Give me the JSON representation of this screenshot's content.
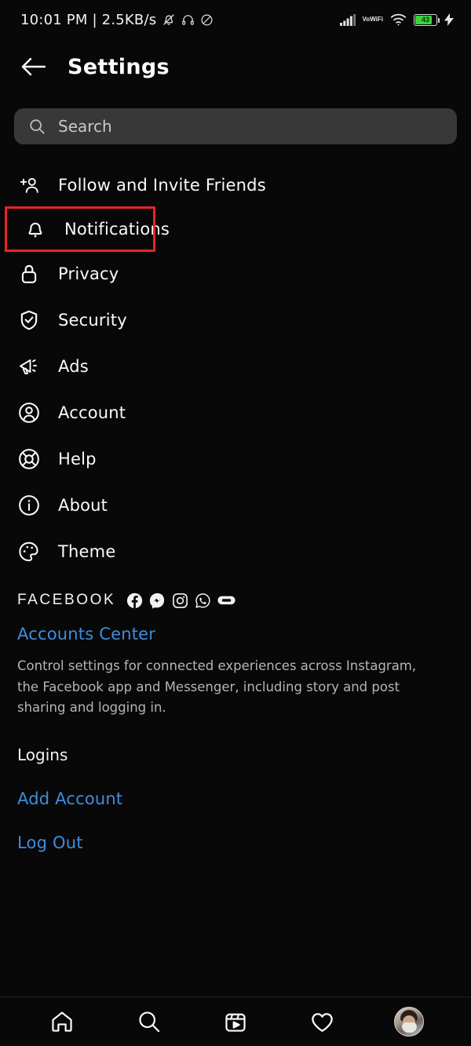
{
  "statusbar": {
    "time_and_net": "10:01 PM | 2.5KB/s",
    "icons_left": [
      "mute-bell-icon",
      "headphone-icon",
      "dnd-icon"
    ],
    "network_label": "Vo\nWiFi",
    "volte_line1": "Vo",
    "volte_line2": "WiFi",
    "battery_percent": "43",
    "icons_right": [
      "signal-bars-icon",
      "volte-wifi-icon",
      "wifi-icon",
      "battery-icon",
      "charging-bolt-icon"
    ]
  },
  "header": {
    "back_icon": "back-arrow-icon",
    "title": "Settings"
  },
  "search": {
    "icon": "search-icon",
    "placeholder": "Search",
    "value": ""
  },
  "menu": {
    "items": [
      {
        "label": "Follow and Invite Friends",
        "icon": "add-person-icon",
        "highlighted": false
      },
      {
        "label": "Notifications",
        "icon": "bell-icon",
        "highlighted": true
      },
      {
        "label": "Privacy",
        "icon": "lock-icon",
        "highlighted": false
      },
      {
        "label": "Security",
        "icon": "shield-check-icon",
        "highlighted": false
      },
      {
        "label": "Ads",
        "icon": "megaphone-icon",
        "highlighted": false
      },
      {
        "label": "Account",
        "icon": "account-circle-icon",
        "highlighted": false
      },
      {
        "label": "Help",
        "icon": "lifebuoy-icon",
        "highlighted": false
      },
      {
        "label": "About",
        "icon": "info-circle-icon",
        "highlighted": false
      },
      {
        "label": "Theme",
        "icon": "palette-icon",
        "highlighted": false
      }
    ]
  },
  "facebook_section": {
    "heading": "FACEBOOK",
    "brand_icons": [
      "facebook-icon",
      "messenger-icon",
      "instagram-icon",
      "whatsapp-icon",
      "oculus-icon"
    ],
    "accounts_center_link": "Accounts Center",
    "description": "Control settings for connected experiences across Instagram, the Facebook app and Messenger, including story and post sharing and logging in.",
    "logins_heading": "Logins",
    "add_account_link": "Add Account",
    "logout_link": "Log Out"
  },
  "bottomnav": {
    "items": [
      {
        "icon": "home-icon",
        "label": "Home"
      },
      {
        "icon": "search-icon",
        "label": "Search"
      },
      {
        "icon": "reels-icon",
        "label": "Reels"
      },
      {
        "icon": "heart-icon",
        "label": "Activity"
      },
      {
        "icon": "profile-avatar",
        "label": "Profile"
      }
    ]
  },
  "colors": {
    "background": "#080808",
    "link_blue": "#3f8ddd",
    "highlight_red": "#e8232a",
    "search_bg": "#383838",
    "text_primary": "#fafafa",
    "text_secondary": "#b5b5b5",
    "battery_green": "#3ad33a"
  }
}
